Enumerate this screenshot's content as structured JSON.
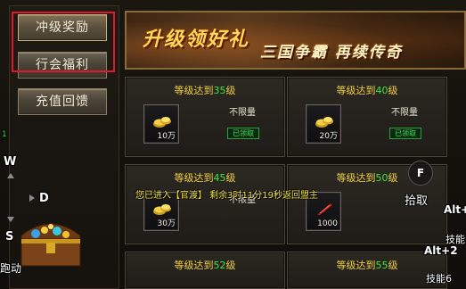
{
  "menu": {
    "items": [
      {
        "label": "冲级奖励",
        "active": true
      },
      {
        "label": "行会福利",
        "active": false
      },
      {
        "label": "充值回馈",
        "active": false
      }
    ]
  },
  "banner": {
    "title": "升级领好礼",
    "subtitle": "三国争霸  再续传奇"
  },
  "rewards": [
    {
      "prefix": "等级达到",
      "level": "35",
      "suffix": "级",
      "amount": "10万",
      "limit": "不限量",
      "status": "已领取",
      "item": "gold-ingot"
    },
    {
      "prefix": "等级达到",
      "level": "40",
      "suffix": "级",
      "amount": "20万",
      "limit": "不限量",
      "status": "已领取",
      "item": "gold-ingot"
    },
    {
      "prefix": "等级达到",
      "level": "45",
      "suffix": "级",
      "amount": "30万",
      "limit": "不限量",
      "status": "",
      "item": "gold-ingot"
    },
    {
      "prefix": "等级达到",
      "level": "50",
      "suffix": "级",
      "amount": "1000",
      "limit": "",
      "status": "",
      "item": "red-feather"
    },
    {
      "prefix": "等级达到",
      "level": "52",
      "suffix": "级",
      "amount": "",
      "limit": "",
      "status": "",
      "item": ""
    },
    {
      "prefix": "等级达到",
      "level": "55",
      "suffix": "级",
      "amount": "",
      "limit": "",
      "status": "",
      "item": ""
    }
  ],
  "hud": {
    "notice": "您已进入【官渡】 剩余3时11分19秒返回盟主",
    "key_w": "W",
    "key_d": "D",
    "key_s": "S",
    "key_f": "F",
    "pickup": "拾取",
    "alt1": "Alt+",
    "alt2": "Alt+2",
    "skill1": "技能",
    "skill2": "技能6",
    "run": "跑动",
    "small_number": "1"
  },
  "colors": {
    "highlight_border": "#e0182a",
    "level_green": "#3ce63c",
    "title_yellow": "#f0d040",
    "claimed_green": "#3ee05a"
  }
}
